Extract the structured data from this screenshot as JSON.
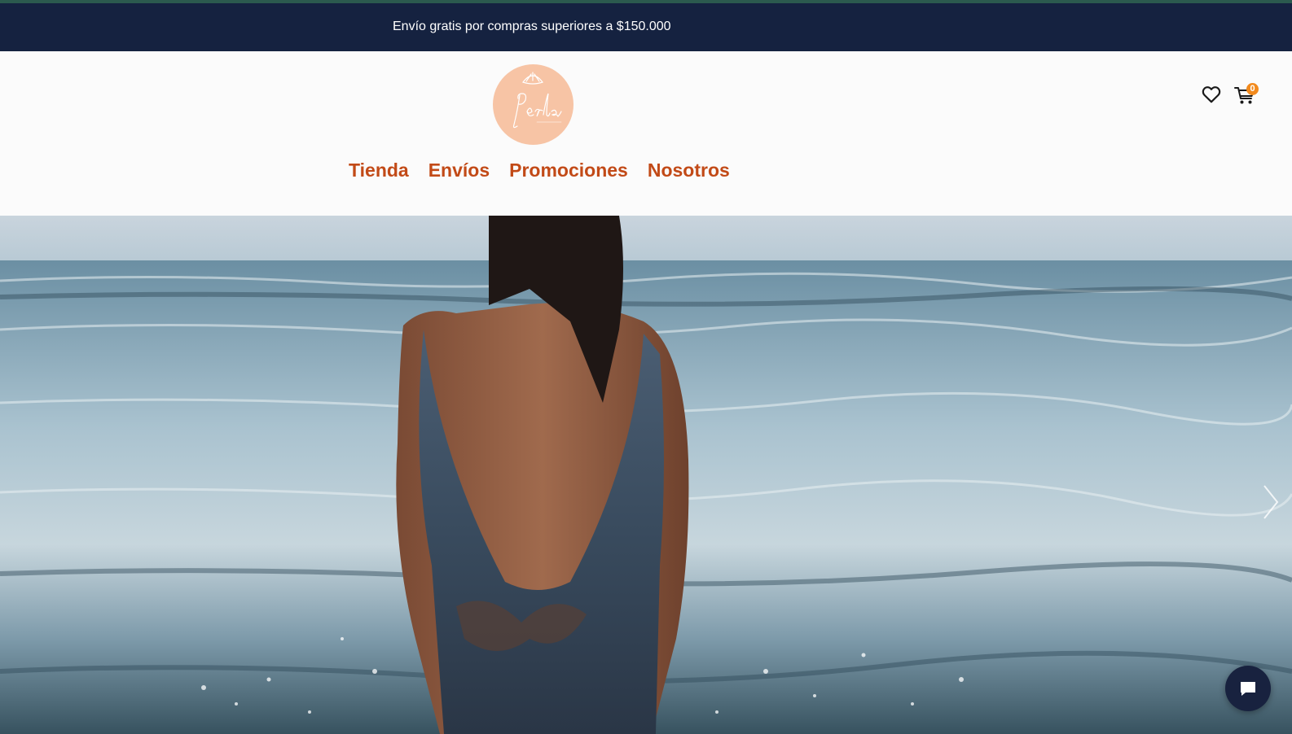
{
  "announcement": {
    "text": "Envío gratis por compras superiores a $150.000"
  },
  "header": {
    "logo": {
      "icon": "shell-icon",
      "wordmark": "Perla"
    },
    "nav": [
      {
        "label": "Tienda"
      },
      {
        "label": "Envíos"
      },
      {
        "label": "Promociones"
      },
      {
        "label": "Nosotros"
      }
    ],
    "wishlist": {
      "icon": "heart-icon"
    },
    "cart": {
      "icon": "cart-icon",
      "count": "0"
    }
  },
  "hero": {
    "image": "woman in patterned swimsuit facing the sea",
    "next_icon": "chevron-right-icon"
  },
  "chat": {
    "icon": "chat-bubble-icon"
  },
  "colors": {
    "announcement_bg": "#152240",
    "header_bg": "#fbfbfb",
    "nav_link": "#c24a17",
    "logo_bg": "#f7c4a5",
    "cart_badge": "#f28a1d",
    "chat_bg": "#18223f"
  }
}
